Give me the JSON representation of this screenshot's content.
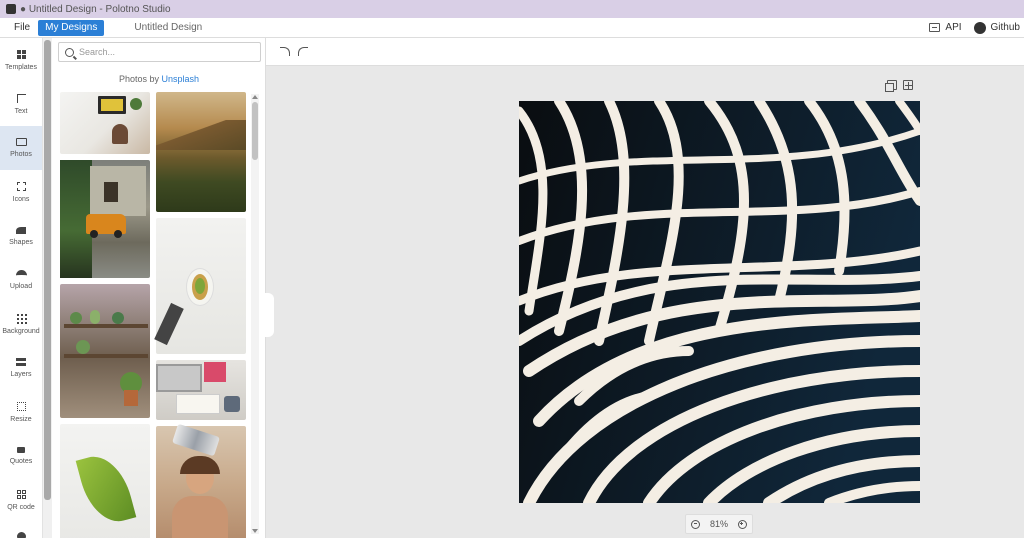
{
  "window": {
    "title": "● Untitled Design - Polotno Studio"
  },
  "menu": {
    "file": "File",
    "my_designs": "My Designs",
    "design_name": "Untitled Design",
    "api": "API",
    "github": "Github"
  },
  "rail": {
    "items": [
      {
        "label": "Templates",
        "icon": "templates-icon"
      },
      {
        "label": "Text",
        "icon": "text-icon"
      },
      {
        "label": "Photos",
        "icon": "photos-icon",
        "active": true
      },
      {
        "label": "Icons",
        "icon": "icons-icon"
      },
      {
        "label": "Shapes",
        "icon": "shapes-icon"
      },
      {
        "label": "Upload",
        "icon": "upload-icon"
      },
      {
        "label": "Background",
        "icon": "background-icon"
      },
      {
        "label": "Layers",
        "icon": "layers-icon"
      },
      {
        "label": "Resize",
        "icon": "resize-icon"
      },
      {
        "label": "Quotes",
        "icon": "quotes-icon"
      },
      {
        "label": "QR code",
        "icon": "qr-code-icon"
      }
    ]
  },
  "panel": {
    "search_placeholder": "Search...",
    "photos_by": "Photos by ",
    "source": "Unsplash"
  },
  "zoom": {
    "value": "81%"
  },
  "colors": {
    "accent": "#2b7fd6",
    "active_tab": "#dde6f2",
    "canvas": "#0b0f14"
  }
}
